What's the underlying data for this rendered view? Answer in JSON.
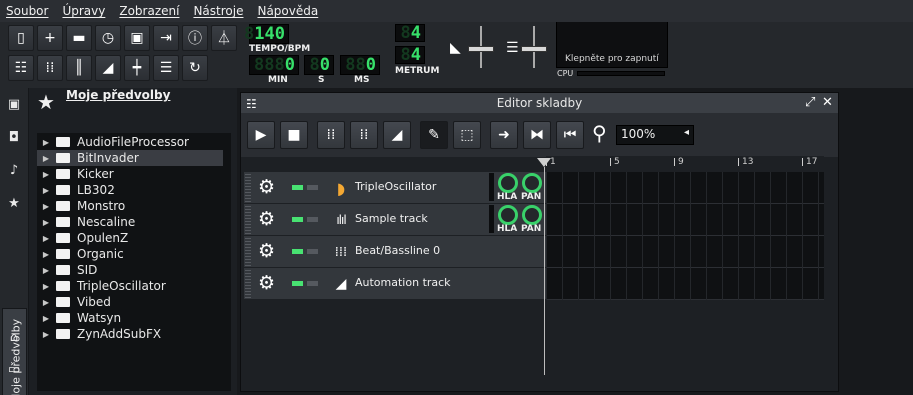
{
  "menu": [
    "Soubor",
    "Úpravy",
    "Zobrazení",
    "Nástroje",
    "Nápověda"
  ],
  "toolbar": {
    "tempo_value": "140",
    "tempo_label": "TEMPO/BPM",
    "time_min": "0",
    "time_s": "0",
    "time_ms": "0",
    "label_min": "MIN",
    "label_s": "S",
    "label_ms": "MS",
    "meter_num": "4",
    "meter_den": "4",
    "meter_label": "METRUM",
    "cpu_hint": "Klepněte pro zapnutí",
    "cpu_label": "CPU"
  },
  "sidebar": {
    "tab_label": "Moje předvolby"
  },
  "presets": {
    "title": "Moje předvolby",
    "items": [
      "AudioFileProcessor",
      "BitInvader",
      "Kicker",
      "LB302",
      "Monstro",
      "Nescaline",
      "OpulenZ",
      "Organic",
      "SID",
      "TripleOscillator",
      "Vibed",
      "Watsyn",
      "ZynAddSubFX"
    ],
    "selected_index": 1
  },
  "editor": {
    "title": "Editor skladby",
    "zoom": "100%",
    "ruler": [
      "1",
      "5",
      "9",
      "13",
      "17"
    ],
    "tracks": [
      {
        "name": "TripleOscillator",
        "icon": "triple-oscillator-icon",
        "knobs": true
      },
      {
        "name": "Sample track",
        "icon": "waveform-icon",
        "knobs": true
      },
      {
        "name": "Beat/Bassline 0",
        "icon": "beat-grid-icon",
        "knobs": false
      },
      {
        "name": "Automation track",
        "icon": "automation-ramp-icon",
        "knobs": false
      }
    ],
    "knob_vol_label": "HLA",
    "knob_pan_label": "PAN"
  },
  "colors": {
    "lcd_green": "#37e06a",
    "knob_green": "#39d16a",
    "led_green": "#48e272"
  }
}
